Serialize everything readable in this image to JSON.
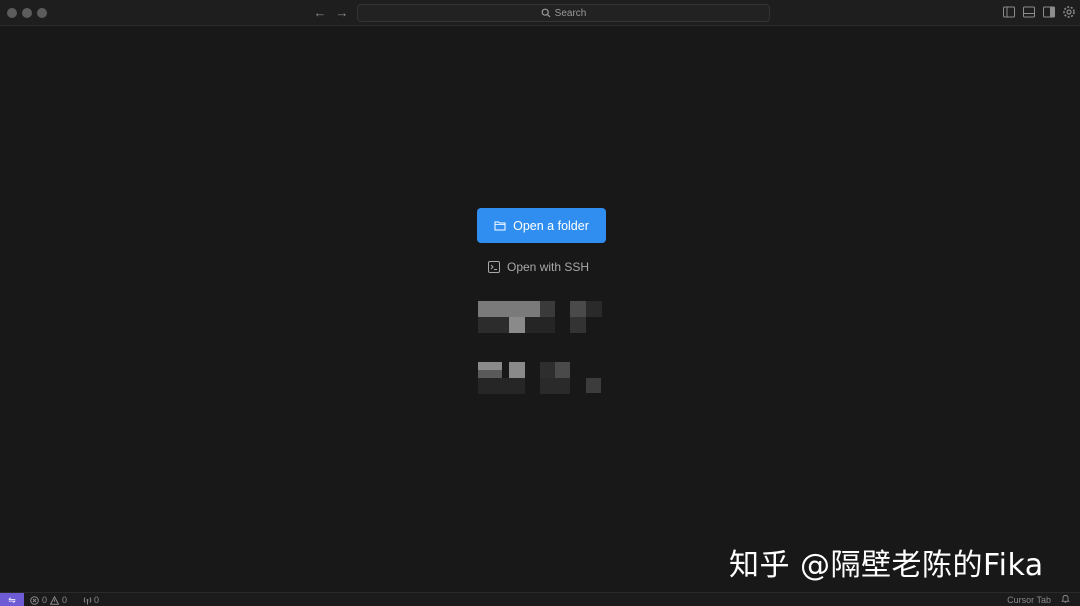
{
  "titlebar": {
    "search_label": "Search",
    "nav_back_icon": "arrow-left-icon",
    "nav_forward_icon": "arrow-right-icon",
    "layout_icons": [
      "toggle-primary-sidebar-icon",
      "toggle-panel-icon",
      "toggle-secondary-sidebar-icon",
      "settings-gear-icon"
    ]
  },
  "welcome": {
    "open_folder_label": "Open a folder",
    "open_ssh_label": "Open with SSH"
  },
  "watermark": {
    "text": "知乎 @隔壁老陈的Fika"
  },
  "statusbar": {
    "errors": "0",
    "warnings": "0",
    "ports": "0",
    "cursor_tab_label": "Cursor Tab"
  },
  "colors": {
    "background": "#181818",
    "accent": "#2f8ef0",
    "remote": "#6e5bd6"
  }
}
